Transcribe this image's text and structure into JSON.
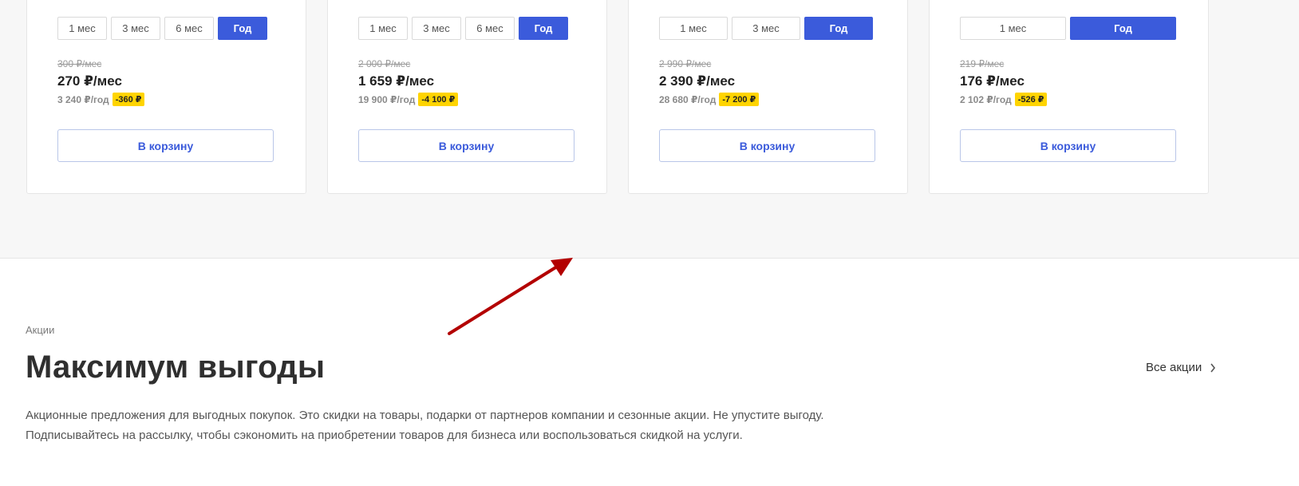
{
  "cards": [
    {
      "periods": [
        {
          "label": "1 мес",
          "active": false
        },
        {
          "label": "3 мес",
          "active": false
        },
        {
          "label": "6 мес",
          "active": false
        },
        {
          "label": "Год",
          "active": true
        }
      ],
      "old_price": "300 ₽/мес",
      "price": "270 ₽/мес",
      "year_price": "3 240 ₽/год",
      "discount": "-360 ₽",
      "cart_label": "В корзину"
    },
    {
      "periods": [
        {
          "label": "1 мес",
          "active": false
        },
        {
          "label": "3 мес",
          "active": false
        },
        {
          "label": "6 мес",
          "active": false
        },
        {
          "label": "Год",
          "active": true
        }
      ],
      "old_price": "2 000 ₽/мес",
      "price": "1 659 ₽/мес",
      "year_price": "19 900 ₽/год",
      "discount": "-4 100 ₽",
      "cart_label": "В корзину"
    },
    {
      "periods": [
        {
          "label": "1 мес",
          "active": false
        },
        {
          "label": "3 мес",
          "active": false
        },
        {
          "label": "Год",
          "active": true
        }
      ],
      "old_price": "2 990 ₽/мес",
      "price": "2 390 ₽/мес",
      "year_price": "28 680 ₽/год",
      "discount": "-7 200 ₽",
      "cart_label": "В корзину"
    },
    {
      "periods": [
        {
          "label": "1 мес",
          "active": false
        },
        {
          "label": "Год",
          "active": true
        }
      ],
      "old_price": "219 ₽/мес",
      "price": "176 ₽/мес",
      "year_price": "2 102 ₽/год",
      "discount": "-526 ₽",
      "cart_label": "В корзину"
    }
  ],
  "promo": {
    "eyebrow": "Акции",
    "title": "Максимум выгоды",
    "all_link": "Все акции",
    "description": "Акционные предложения для выгодных покупок. Это скидки на товары, подарки от партнеров компании и сезонные акции. Не упустите выгоду. Подписывайтесь на рассылку, чтобы сэкономить на приобретении товаров для бизнеса или воспользоваться скидкой на услуги."
  },
  "colors": {
    "accent": "#3b5bdb",
    "discount_badge": "#ffd400",
    "annotation_arrow": "#b30000"
  },
  "icons": {
    "all_link_icon": "chevron-right-icon",
    "annotation": "arrow-icon"
  }
}
